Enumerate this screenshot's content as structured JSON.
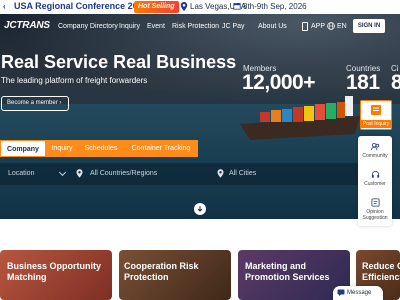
{
  "promo": {
    "title": "USA Regional Conference 2026",
    "badge": "Hot Selling",
    "location": "Las Vegas,USA",
    "date": "8th-9th Sep, 2026"
  },
  "nav": {
    "logo": "JCTRANS",
    "items": [
      "Company Directory",
      "Inquiry",
      "Event",
      "Risk Protection",
      "JC Pay",
      "About Us"
    ],
    "app": "APP",
    "language": "EN",
    "sign_in": "SIGN IN"
  },
  "hero": {
    "headline": "Real Service Real Business",
    "tagline": "The leading platform of freight forwarders",
    "cta": "Become a member",
    "stats": [
      {
        "label": "Members",
        "value": "12,000+"
      },
      {
        "label": "Countries",
        "value": "181"
      },
      {
        "label": "Ci",
        "value": "8"
      }
    ]
  },
  "search": {
    "tabs": [
      "Company",
      "Inquiry",
      "Schedules",
      "Container Tracking"
    ],
    "location_label": "Location",
    "countries_placeholder": "All Countries/Regions",
    "cities_placeholder": "All Cities"
  },
  "sidebar": {
    "post_inquiry": "Post Inquiry",
    "items": [
      "Community",
      "Customer",
      "Opinion Suggestion"
    ]
  },
  "cards": [
    {
      "title": "Business Opportunity Matching"
    },
    {
      "title": "Cooperation Risk Protection"
    },
    {
      "title": "Marketing and Promotion Services"
    },
    {
      "title": "Reduce C Efficiency"
    }
  ],
  "message": "Message",
  "colors": {
    "accent": "#ff8c1a",
    "brand": "#1f3a8a"
  }
}
